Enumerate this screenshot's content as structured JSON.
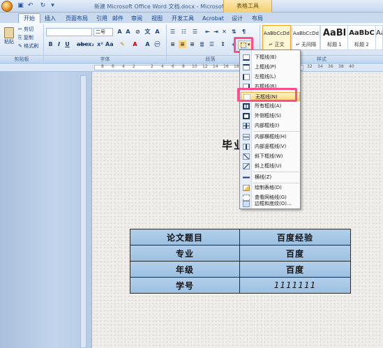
{
  "window": {
    "title": "新建 Microsoft Office Word 文档.docx - Microsoft Word",
    "context_tab": "表格工具"
  },
  "tabs": [
    {
      "label": "开始"
    },
    {
      "label": "插入"
    },
    {
      "label": "页面布局"
    },
    {
      "label": "引用"
    },
    {
      "label": "邮件"
    },
    {
      "label": "审阅"
    },
    {
      "label": "视图"
    },
    {
      "label": "开发工具"
    },
    {
      "label": "Acrobat"
    },
    {
      "label": "设计"
    },
    {
      "label": "布局"
    }
  ],
  "clipboard": {
    "paste": "粘贴",
    "cut": "剪切",
    "copy": "复制",
    "format_painter": "格式刷",
    "group": "剪贴板"
  },
  "font": {
    "size": "二号",
    "group": "字体"
  },
  "paragraph": {
    "group": "段落"
  },
  "styles": {
    "group": "样式",
    "items": [
      {
        "sample": "AaBbCcDd",
        "name": "↵ 正文"
      },
      {
        "sample": "AaBbCcDd",
        "name": "↵ 无间隔"
      },
      {
        "sample": "AaBl",
        "name": "标题 1"
      },
      {
        "sample": "AaBbC",
        "name": "标题 2"
      },
      {
        "sample": "AaBbC",
        "name": ""
      }
    ]
  },
  "ruler_numbers": [
    "8",
    "6",
    "4",
    "2",
    "2",
    "4",
    "6",
    "8",
    "10",
    "12",
    "14",
    "16",
    "18",
    "20",
    "22",
    "24",
    "26",
    "28",
    "30",
    "32",
    "34",
    "36",
    "38",
    "40"
  ],
  "border_menu": {
    "items": [
      {
        "label": "下框线(B)"
      },
      {
        "label": "上框线(P)"
      },
      {
        "label": "左框线(L)"
      },
      {
        "label": "右框线(R)"
      },
      {
        "label": "无框线(N)"
      },
      {
        "label": "所有框线(A)"
      },
      {
        "label": "外侧框线(S)"
      },
      {
        "label": "内部框线(I)"
      },
      {
        "label": "内部横框线(H)"
      },
      {
        "label": "内部竖框线(V)"
      },
      {
        "label": "斜下框线(W)"
      },
      {
        "label": "斜上框线(U)"
      },
      {
        "label": "横线(Z)"
      },
      {
        "label": "绘制表格(D)"
      },
      {
        "label": "查看网格线(G)"
      },
      {
        "label": "边框和底纹(O)..."
      }
    ]
  },
  "document": {
    "heading": "毕业",
    "table": [
      [
        "论文题目",
        "百度经验"
      ],
      [
        "专业",
        "百度"
      ],
      [
        "年级",
        "百度"
      ],
      [
        "学号",
        "1111111"
      ]
    ]
  }
}
